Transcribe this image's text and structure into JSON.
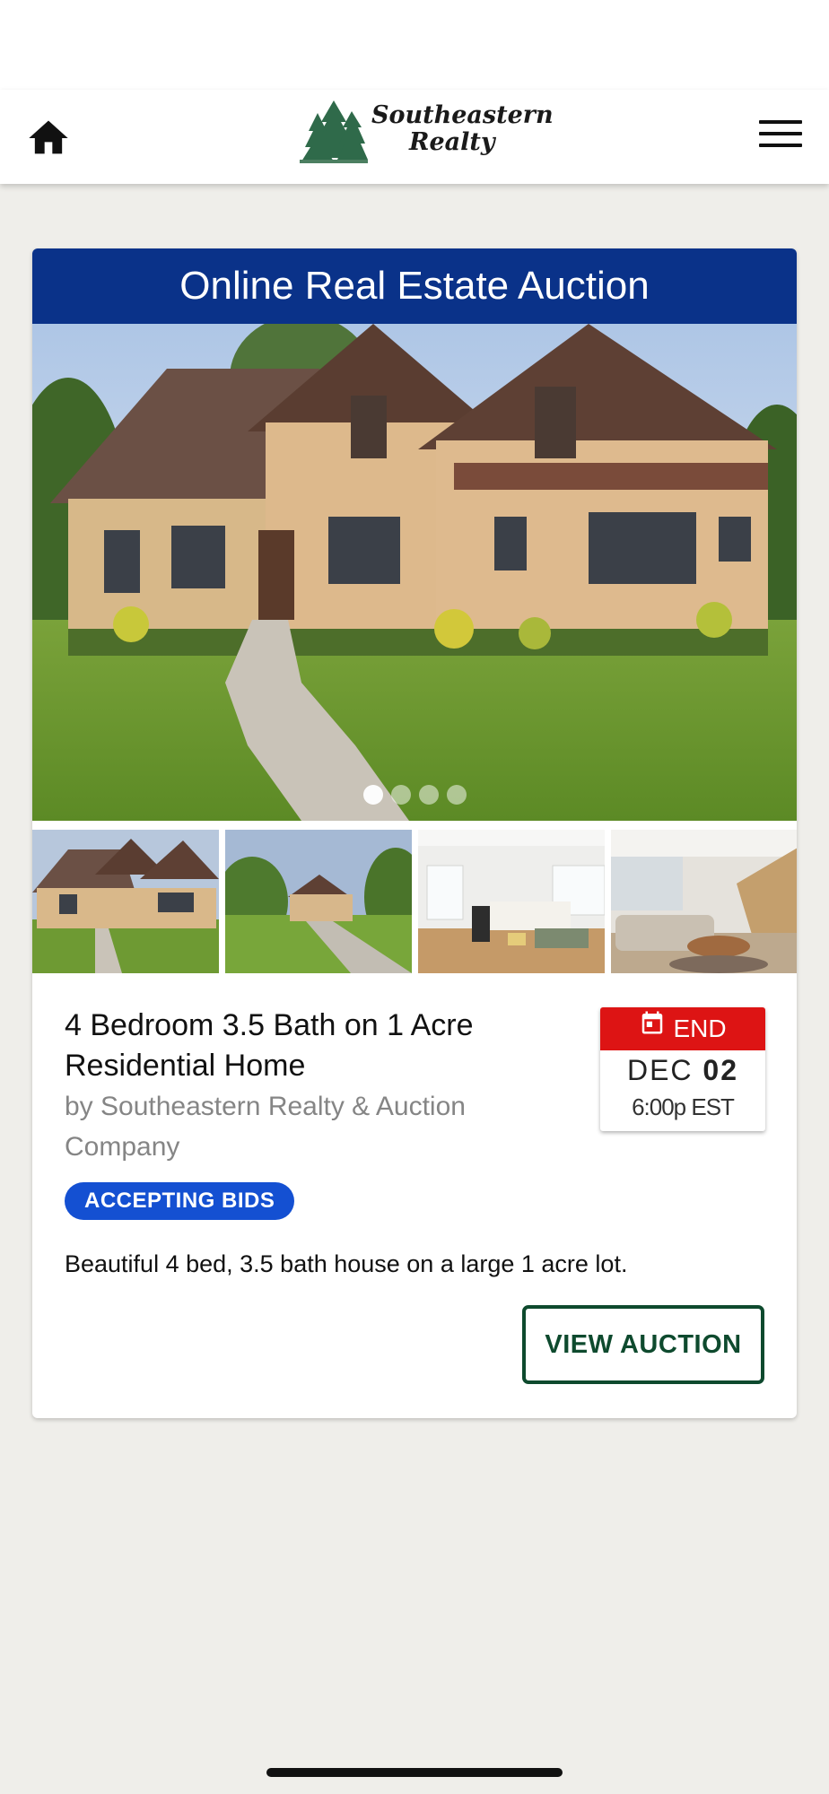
{
  "header": {
    "logo_line1": "Southeastern",
    "logo_line2": "Realty",
    "home_icon": "home-icon",
    "menu_icon": "hamburger-menu-icon"
  },
  "auction": {
    "banner": "Online Real Estate Auction",
    "carousel": {
      "slide_count": 4,
      "active_slide": 1
    },
    "thumbnails": [
      "exterior-front-photo",
      "exterior-yard-photo",
      "living-room-photo",
      "open-living-area-photo"
    ],
    "title": "4 Bedroom 3.5 Bath on 1 Acre Residential Home",
    "byline": "by Southeastern Realty & Auction Company",
    "status": "ACCEPTING BIDS",
    "end": {
      "label": "END",
      "month": "DEC",
      "day": "02",
      "time": "6:00p EST"
    },
    "description": "Beautiful 4 bed, 3.5 bath house on a large 1 acre lot.",
    "button": "VIEW AUCTION"
  },
  "colors": {
    "banner_blue": "#0a3289",
    "badge_blue": "#1450d2",
    "end_red": "#dd1414",
    "button_green": "#0e4a2e",
    "page_bg": "#efeeea"
  }
}
